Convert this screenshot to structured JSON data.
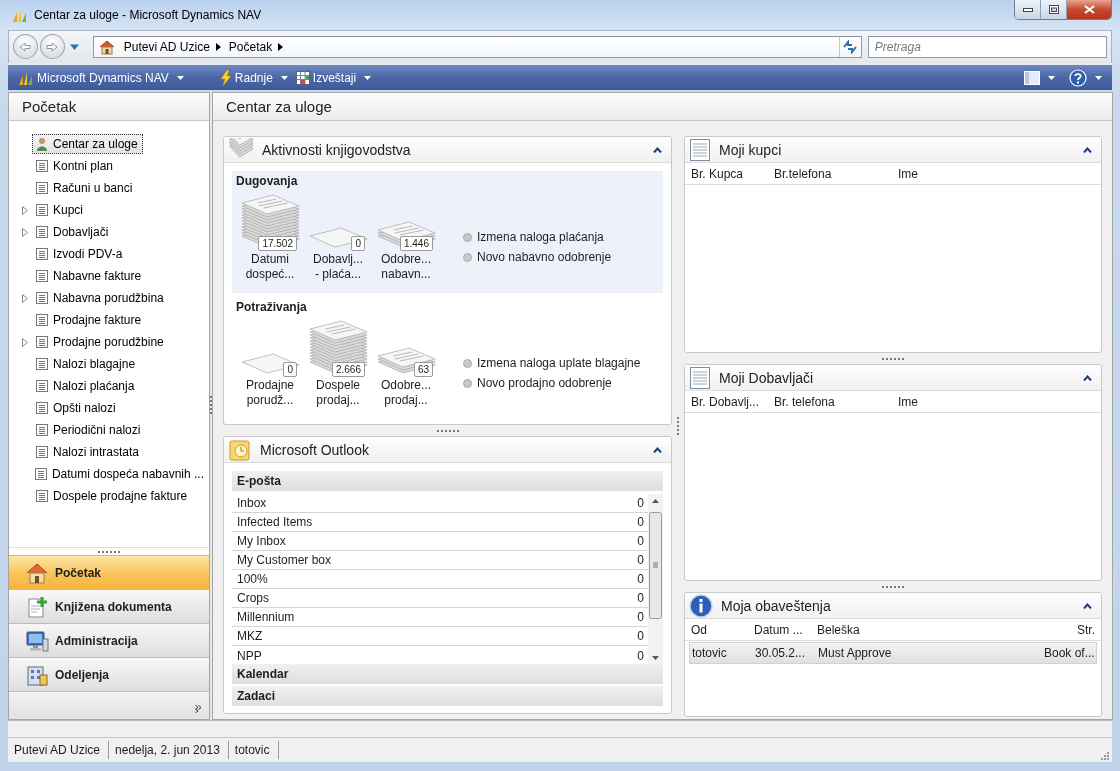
{
  "window": {
    "title": "Centar za uloge - Microsoft Dynamics NAV"
  },
  "address_bar": {
    "breadcrumbs": [
      "Putevi AD Uzice",
      "Početak"
    ]
  },
  "search": {
    "placeholder": "Pretraga"
  },
  "command_bar": {
    "menus": [
      "Microsoft Dynamics NAV",
      "Radnje",
      "Izveštaji"
    ]
  },
  "navigation_pane": {
    "title": "Početak",
    "items": [
      {
        "label": "Centar za uloge",
        "kind": "role_center",
        "expandable": false,
        "selected": true
      },
      {
        "label": "Kontni plan",
        "kind": "list",
        "expandable": false,
        "selected": false
      },
      {
        "label": "Računi u banci",
        "kind": "list",
        "expandable": false,
        "selected": false
      },
      {
        "label": "Kupci",
        "kind": "list",
        "expandable": true,
        "selected": false
      },
      {
        "label": "Dobavljači",
        "kind": "list",
        "expandable": true,
        "selected": false
      },
      {
        "label": "Izvodi PDV-a",
        "kind": "list",
        "expandable": false,
        "selected": false
      },
      {
        "label": "Nabavne fakture",
        "kind": "list",
        "expandable": false,
        "selected": false
      },
      {
        "label": "Nabavna porudžbina",
        "kind": "list",
        "expandable": true,
        "selected": false
      },
      {
        "label": "Prodajne fakture",
        "kind": "list",
        "expandable": false,
        "selected": false
      },
      {
        "label": "Prodajne porudžbine",
        "kind": "list",
        "expandable": true,
        "selected": false
      },
      {
        "label": "Nalozi blagajne",
        "kind": "list",
        "expandable": false,
        "selected": false
      },
      {
        "label": "Nalozi plaćanja",
        "kind": "list",
        "expandable": false,
        "selected": false
      },
      {
        "label": "Opšti nalozi",
        "kind": "list",
        "expandable": false,
        "selected": false
      },
      {
        "label": "Periodični nalozi",
        "kind": "list",
        "expandable": false,
        "selected": false
      },
      {
        "label": "Nalozi intrastata",
        "kind": "list",
        "expandable": false,
        "selected": false
      },
      {
        "label": "Datumi dospeća nabavnih ...",
        "kind": "list",
        "expandable": false,
        "selected": false
      },
      {
        "label": "Dospele prodajne fakture",
        "kind": "list",
        "expandable": false,
        "selected": false
      }
    ],
    "buttons": [
      {
        "label": "Početak",
        "selected": true
      },
      {
        "label": "Knjižena dokumenta",
        "selected": false
      },
      {
        "label": "Administracija",
        "selected": false
      },
      {
        "label": "Odeljenja",
        "selected": false
      }
    ]
  },
  "content": {
    "title": "Centar za uloge",
    "columns": [
      {
        "parts": [
          {
            "kind": "activities",
            "title": "Aktivnosti knjigovodstva",
            "expanded": true,
            "groups": [
              {
                "title": "Dugovanja",
                "selected": true,
                "cues": [
                  {
                    "kind": "tall",
                    "count": "17.502",
                    "label_lines": [
                      "Datumi",
                      "dospeć..."
                    ]
                  },
                  {
                    "kind": "single",
                    "count": "0",
                    "label_lines": [
                      "Dobavlj...",
                      "- plaća..."
                    ]
                  },
                  {
                    "kind": "few",
                    "count": "1.446",
                    "label_lines": [
                      "Odobre...",
                      "nabavn..."
                    ]
                  }
                ],
                "actions": [
                  "Izmena naloga plaćanja",
                  "Novo nabavno odobrenje"
                ]
              },
              {
                "title": "Potraživanja",
                "selected": false,
                "cues": [
                  {
                    "kind": "single",
                    "count": "0",
                    "label_lines": [
                      "Prodajne",
                      "porudž..."
                    ]
                  },
                  {
                    "kind": "tall",
                    "count": "2.666",
                    "label_lines": [
                      "Dospele",
                      "prodaj..."
                    ]
                  },
                  {
                    "kind": "few",
                    "count": "63",
                    "label_lines": [
                      "Odobre...",
                      "prodaj..."
                    ]
                  }
                ],
                "actions": [
                  "Izmena naloga uplate blagajne",
                  "Novo prodajno odobrenje"
                ]
              }
            ]
          },
          {
            "kind": "outlook",
            "title": "Microsoft Outlook",
            "expanded": true,
            "sections": [
              {
                "title": "E-pošta",
                "expanded": true,
                "rows": [
                  {
                    "name": "Inbox",
                    "count": "0"
                  },
                  {
                    "name": "Infected Items",
                    "count": "0"
                  },
                  {
                    "name": "My Inbox",
                    "count": "0"
                  },
                  {
                    "name": "My Customer box",
                    "count": "0"
                  },
                  {
                    "name": "100%",
                    "count": "0"
                  },
                  {
                    "name": "Crops",
                    "count": "0"
                  },
                  {
                    "name": "Millennium",
                    "count": "0"
                  },
                  {
                    "name": "MKZ",
                    "count": "0"
                  },
                  {
                    "name": "NPP",
                    "count": "0"
                  }
                ]
              },
              {
                "title": "Kalendar",
                "expanded": false
              },
              {
                "title": "Zadaci",
                "expanded": false
              }
            ]
          }
        ]
      },
      {
        "parts": [
          {
            "kind": "list",
            "title": "Moji kupci",
            "expanded": true,
            "columns": [
              "Br. Kupca",
              "Br.telefona",
              "Ime"
            ]
          },
          {
            "kind": "list",
            "title": "Moji Dobavljači",
            "expanded": true,
            "columns": [
              "Br. Dobavlj...",
              "Br. telefona",
              "Ime"
            ]
          },
          {
            "kind": "notifications",
            "title": "Moja obaveštenja",
            "expanded": true,
            "columns": [
              "Od",
              "Datum ...",
              "Beleška",
              "Str."
            ],
            "rows": [
              {
                "cells": [
                  "totovic",
                  "30.05.2...",
                  "Must Approve",
                  "Book of..."
                ],
                "selected": true
              }
            ]
          }
        ]
      }
    ]
  },
  "status_bar": [
    "Putevi AD Uzice",
    "nedelja, 2. jun 2013",
    "totovic"
  ]
}
